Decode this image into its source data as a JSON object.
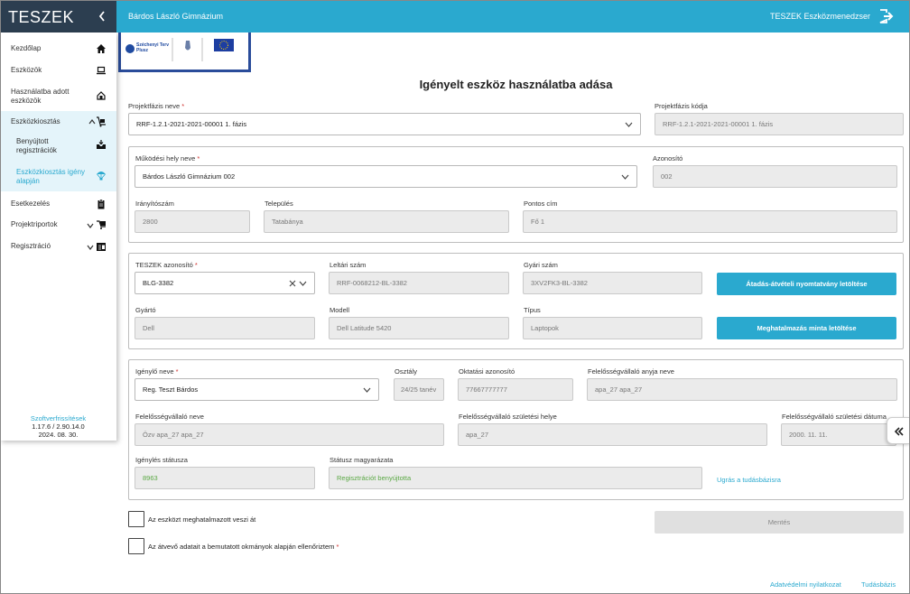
{
  "app": {
    "brand": "TESZEK",
    "school": "Bárdos László Gimnázium",
    "tool": "TESZEK Eszközmenedzser"
  },
  "sidebar": {
    "items": [
      {
        "label": "Kezdőlap",
        "icon": "home-icon"
      },
      {
        "label": "Eszközök",
        "icon": "laptop-icon"
      },
      {
        "label": "Használatba adott eszközök",
        "icon": "handover-icon"
      },
      {
        "label": "Eszközkiosztás",
        "icon": "dolly-icon"
      },
      {
        "label": "Benyújtott regisztrációk",
        "icon": "inbox-icon"
      },
      {
        "label": "Eszközkiosztás igény alapján",
        "icon": "parachute-icon"
      },
      {
        "label": "Esetkezelés",
        "icon": "clipboard-icon"
      },
      {
        "label": "Projektriportok",
        "icon": "reports-icon"
      },
      {
        "label": "Regisztráció",
        "icon": "registration-icon"
      }
    ],
    "software_updates_label": "Szoftverfrissítések",
    "version": "1.17.6 / 2.90.14.0",
    "date": "2024. 08. 30."
  },
  "page": {
    "title": "Igényelt eszköz használatba adása"
  },
  "project": {
    "phase_name_label": "Projektfázis neve",
    "phase_name_value": "RRF-1.2.1-2021-2021-00001 1. fázis",
    "phase_code_label": "Projektfázis kódja",
    "phase_code_value": "RRF-1.2.1-2021-2021-00001 1. fázis"
  },
  "site": {
    "name_label": "Működési hely neve",
    "name_value": "Bárdos László Gimnázium 002",
    "id_label": "Azonosító",
    "id_value": "002",
    "zip_label": "Irányítószám",
    "zip_value": "2800",
    "city_label": "Település",
    "city_value": "Tatabánya",
    "address_label": "Pontos cím",
    "address_value": "Fő 1"
  },
  "device": {
    "teszek_id_label": "TESZEK azonosító",
    "teszek_id_value": "BLG-3382",
    "inventory_label": "Leltári szám",
    "inventory_value": "RRF-0068212-BL-3382",
    "serial_label": "Gyári szám",
    "serial_value": "3XV2FK3-BL-3382",
    "manufacturer_label": "Gyártó",
    "manufacturer_value": "Dell",
    "model_label": "Modell",
    "model_value": "Dell Latitude 5420",
    "type_label": "Típus",
    "type_value": "Laptopok",
    "download_handover_label": "Átadás-átvételi nyomtatvány letöltése",
    "download_authorization_label": "Meghatalmazás minta letöltése"
  },
  "requester": {
    "name_label": "Igénylő neve",
    "name_value": "Reg. Teszt Bárdos",
    "class_label": "Osztály",
    "class_value": "24/25 tanév",
    "edu_id_label": "Oktatási azonosító",
    "edu_id_value": "77667777777",
    "guardian_mother_label": "Felelősségvállaló anyja neve",
    "guardian_mother_value": "apa_27 apa_27",
    "guardian_name_label": "Felelősségvállaló neve",
    "guardian_name_value": "Özv apa_27 apa_27",
    "guardian_birthplace_label": "Felelősségvállaló születési helye",
    "guardian_birthplace_value": "apa_27",
    "guardian_birthdate_label": "Felelősségvállaló születési dátuma",
    "guardian_birthdate_value": "2000. 11. 11.",
    "status_label": "Igénylés státusza",
    "status_value": "8963",
    "status_desc_label": "Státusz magyarázata",
    "status_desc_value": "Regisztrációt benyújtotta",
    "kb_link": "Ugrás a tudásbázisra"
  },
  "checks": {
    "authorized_label": "Az eszközt meghatalmazott veszi át",
    "verified_label": "Az átvevő adatait a bemutatott okmányok alapján ellenőriztem",
    "save_label": "Mentés"
  },
  "footer": {
    "privacy": "Adatvédelmi nyilatkozat",
    "kb": "Tudásbázis"
  },
  "colors": {
    "accent": "#2aa9cf",
    "brand_bg": "#2c3e50",
    "status_green": "#5aa844",
    "required": "#d0312d"
  }
}
